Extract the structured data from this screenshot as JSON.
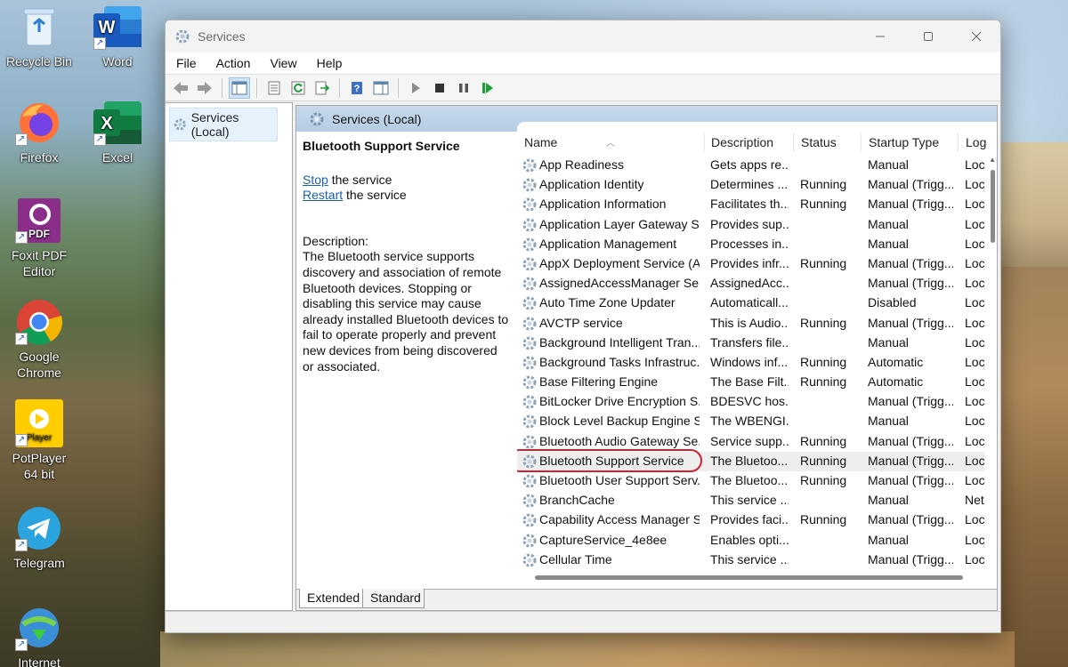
{
  "desktop": {
    "icons": [
      {
        "label": "Recycle Bin"
      },
      {
        "label": "Word"
      },
      {
        "label": "Firefox"
      },
      {
        "label": "Excel"
      },
      {
        "label": "Foxit PDF Editor"
      },
      {
        "label": "Google Chrome"
      },
      {
        "label": "PotPlayer 64 bit"
      },
      {
        "label": "Telegram"
      },
      {
        "label": "Internet"
      }
    ]
  },
  "window": {
    "title": "Services",
    "menu": [
      "File",
      "Action",
      "View",
      "Help"
    ],
    "tree_item": "Services (Local)",
    "pane_header": "Services (Local)",
    "detail": {
      "service_name": "Bluetooth Support Service",
      "stop_link": "Stop",
      "stop_suffix": " the service",
      "restart_link": "Restart",
      "restart_suffix": " the service",
      "description_label": "Description:",
      "description": "The Bluetooth service supports discovery and association of remote Bluetooth devices.  Stopping or disabling this service may cause already installed Bluetooth devices to fail to operate properly and prevent new devices from being discovered or associated."
    },
    "columns": [
      "Name",
      "Description",
      "Status",
      "Startup Type",
      "Log"
    ],
    "rows": [
      {
        "name": "App Readiness",
        "desc": "Gets apps re...",
        "status": "",
        "startup": "Manual",
        "log": "Loc"
      },
      {
        "name": "Application Identity",
        "desc": "Determines ...",
        "status": "Running",
        "startup": "Manual (Trigg...",
        "log": "Loc"
      },
      {
        "name": "Application Information",
        "desc": "Facilitates th...",
        "status": "Running",
        "startup": "Manual (Trigg...",
        "log": "Loc"
      },
      {
        "name": "Application Layer Gateway S...",
        "desc": "Provides sup...",
        "status": "",
        "startup": "Manual",
        "log": "Loc"
      },
      {
        "name": "Application Management",
        "desc": "Processes in...",
        "status": "",
        "startup": "Manual",
        "log": "Loc"
      },
      {
        "name": "AppX Deployment Service (A...",
        "desc": "Provides infr...",
        "status": "Running",
        "startup": "Manual (Trigg...",
        "log": "Loc"
      },
      {
        "name": "AssignedAccessManager Ser...",
        "desc": "AssignedAcc...",
        "status": "",
        "startup": "Manual (Trigg...",
        "log": "Loc"
      },
      {
        "name": "Auto Time Zone Updater",
        "desc": "Automaticall...",
        "status": "",
        "startup": "Disabled",
        "log": "Loc"
      },
      {
        "name": "AVCTP service",
        "desc": "This is Audio...",
        "status": "Running",
        "startup": "Manual (Trigg...",
        "log": "Loc"
      },
      {
        "name": "Background Intelligent Tran...",
        "desc": "Transfers file...",
        "status": "",
        "startup": "Manual",
        "log": "Loc"
      },
      {
        "name": "Background Tasks Infrastruc...",
        "desc": "Windows inf...",
        "status": "Running",
        "startup": "Automatic",
        "log": "Loc"
      },
      {
        "name": "Base Filtering Engine",
        "desc": "The Base Filt...",
        "status": "Running",
        "startup": "Automatic",
        "log": "Loc"
      },
      {
        "name": "BitLocker Drive Encryption S...",
        "desc": "BDESVC hos...",
        "status": "",
        "startup": "Manual (Trigg...",
        "log": "Loc"
      },
      {
        "name": "Block Level Backup Engine S...",
        "desc": "The WBENGI...",
        "status": "",
        "startup": "Manual",
        "log": "Loc"
      },
      {
        "name": "Bluetooth Audio Gateway Se...",
        "desc": "Service supp...",
        "status": "Running",
        "startup": "Manual (Trigg...",
        "log": "Loc"
      },
      {
        "name": "Bluetooth Support Service",
        "desc": "The Bluetoo...",
        "status": "Running",
        "startup": "Manual (Trigg...",
        "log": "Loc",
        "selected": true
      },
      {
        "name": "Bluetooth User Support Serv...",
        "desc": "The Bluetoo...",
        "status": "Running",
        "startup": "Manual (Trigg...",
        "log": "Loc"
      },
      {
        "name": "BranchCache",
        "desc": "This service ...",
        "status": "",
        "startup": "Manual",
        "log": "Net"
      },
      {
        "name": "Capability Access Manager S...",
        "desc": "Provides faci...",
        "status": "Running",
        "startup": "Manual (Trigg...",
        "log": "Loc"
      },
      {
        "name": "CaptureService_4e8ee",
        "desc": "Enables opti...",
        "status": "",
        "startup": "Manual",
        "log": "Loc"
      },
      {
        "name": "Cellular Time",
        "desc": "This service ...",
        "status": "",
        "startup": "Manual (Trigg...",
        "log": "Loc"
      }
    ],
    "tabs": [
      "Extended",
      "Standard"
    ],
    "highlight_color": "#d2202f"
  }
}
